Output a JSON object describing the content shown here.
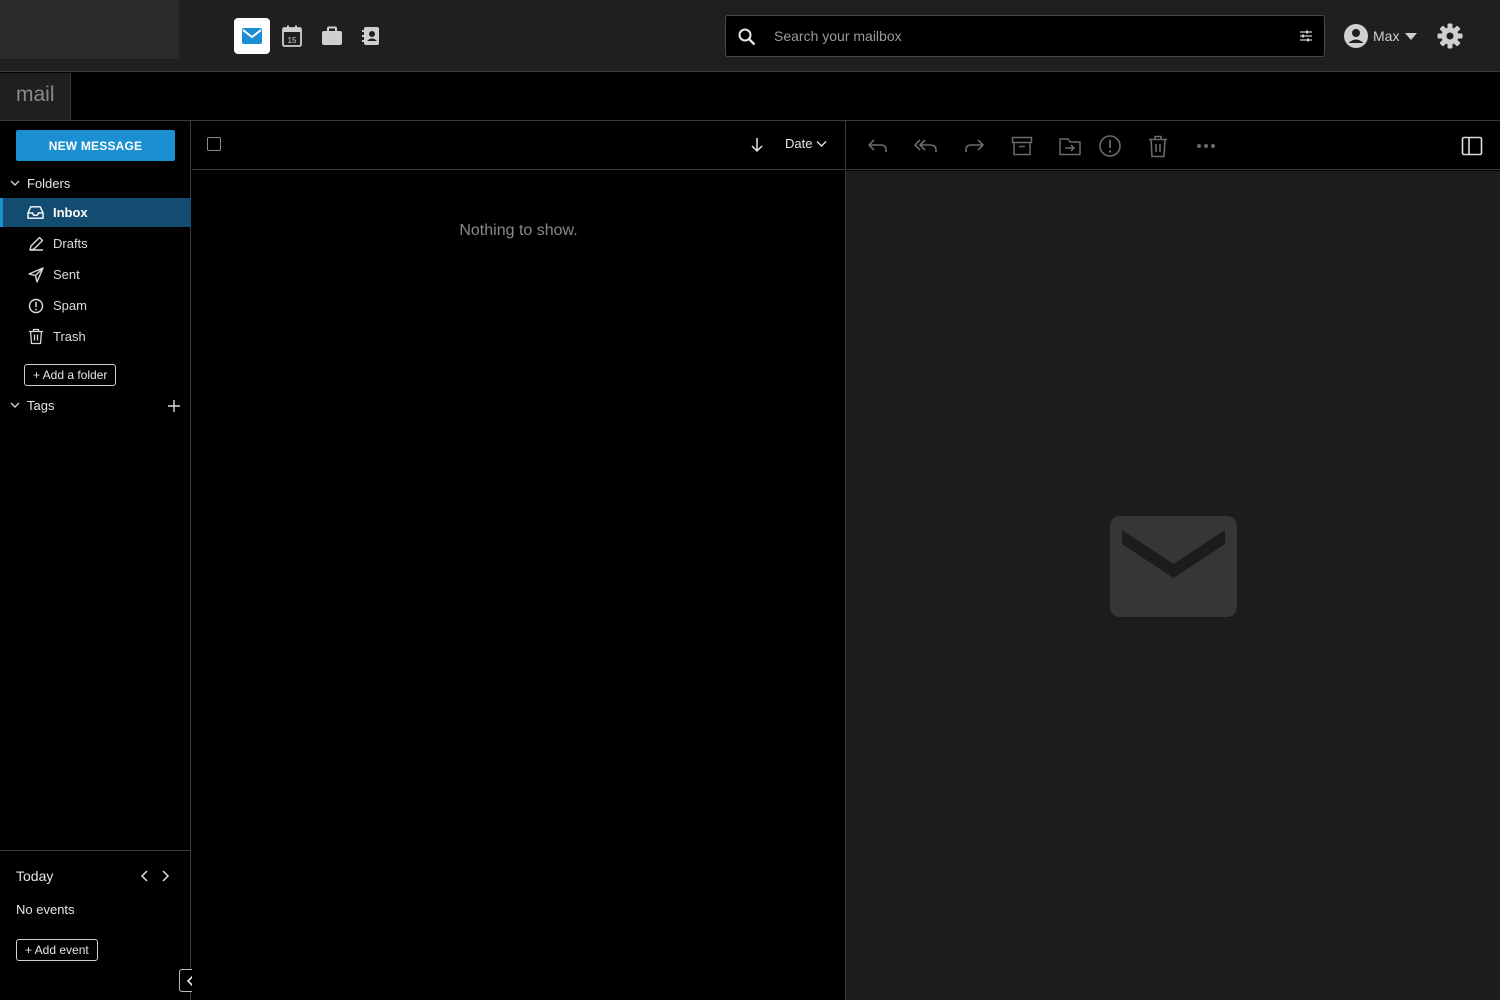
{
  "app": {
    "title": "mail"
  },
  "topbar": {
    "apps": [
      {
        "name": "mail",
        "icon": "mail-icon",
        "active": true
      },
      {
        "name": "calendar",
        "icon": "calendar-icon",
        "day": "15"
      },
      {
        "name": "briefcase",
        "icon": "briefcase-icon"
      },
      {
        "name": "contacts",
        "icon": "contacts-icon"
      }
    ],
    "search": {
      "placeholder": "Search your mailbox",
      "value": ""
    },
    "user": {
      "name": "Max"
    }
  },
  "sidebar": {
    "new_message_label": "NEW MESSAGE",
    "folders_label": "Folders",
    "folders": [
      {
        "label": "Inbox",
        "icon": "inbox-icon",
        "active": true
      },
      {
        "label": "Drafts",
        "icon": "pencil-icon"
      },
      {
        "label": "Sent",
        "icon": "send-icon"
      },
      {
        "label": "Spam",
        "icon": "spam-icon"
      },
      {
        "label": "Trash",
        "icon": "trash-icon"
      }
    ],
    "add_folder_label": "+ Add a folder",
    "tags_label": "Tags"
  },
  "agenda": {
    "today_label": "Today",
    "no_events_label": "No events",
    "add_event_label": "+ Add event"
  },
  "message_list": {
    "sort_label": "Date",
    "empty_text": "Nothing to show."
  },
  "reading_pane": {
    "toolbar": [
      "reply-icon",
      "reply-all-icon",
      "forward-icon",
      "archive-icon",
      "move-icon",
      "spam-icon",
      "trash-icon",
      "more-icon",
      "layout-toggle-icon"
    ]
  },
  "colors": {
    "accent": "#1a8fd1",
    "active_folder_bg": "#124c70",
    "topbar_bg": "#1f1f1f",
    "pane_bg": "#1c1c1c"
  }
}
